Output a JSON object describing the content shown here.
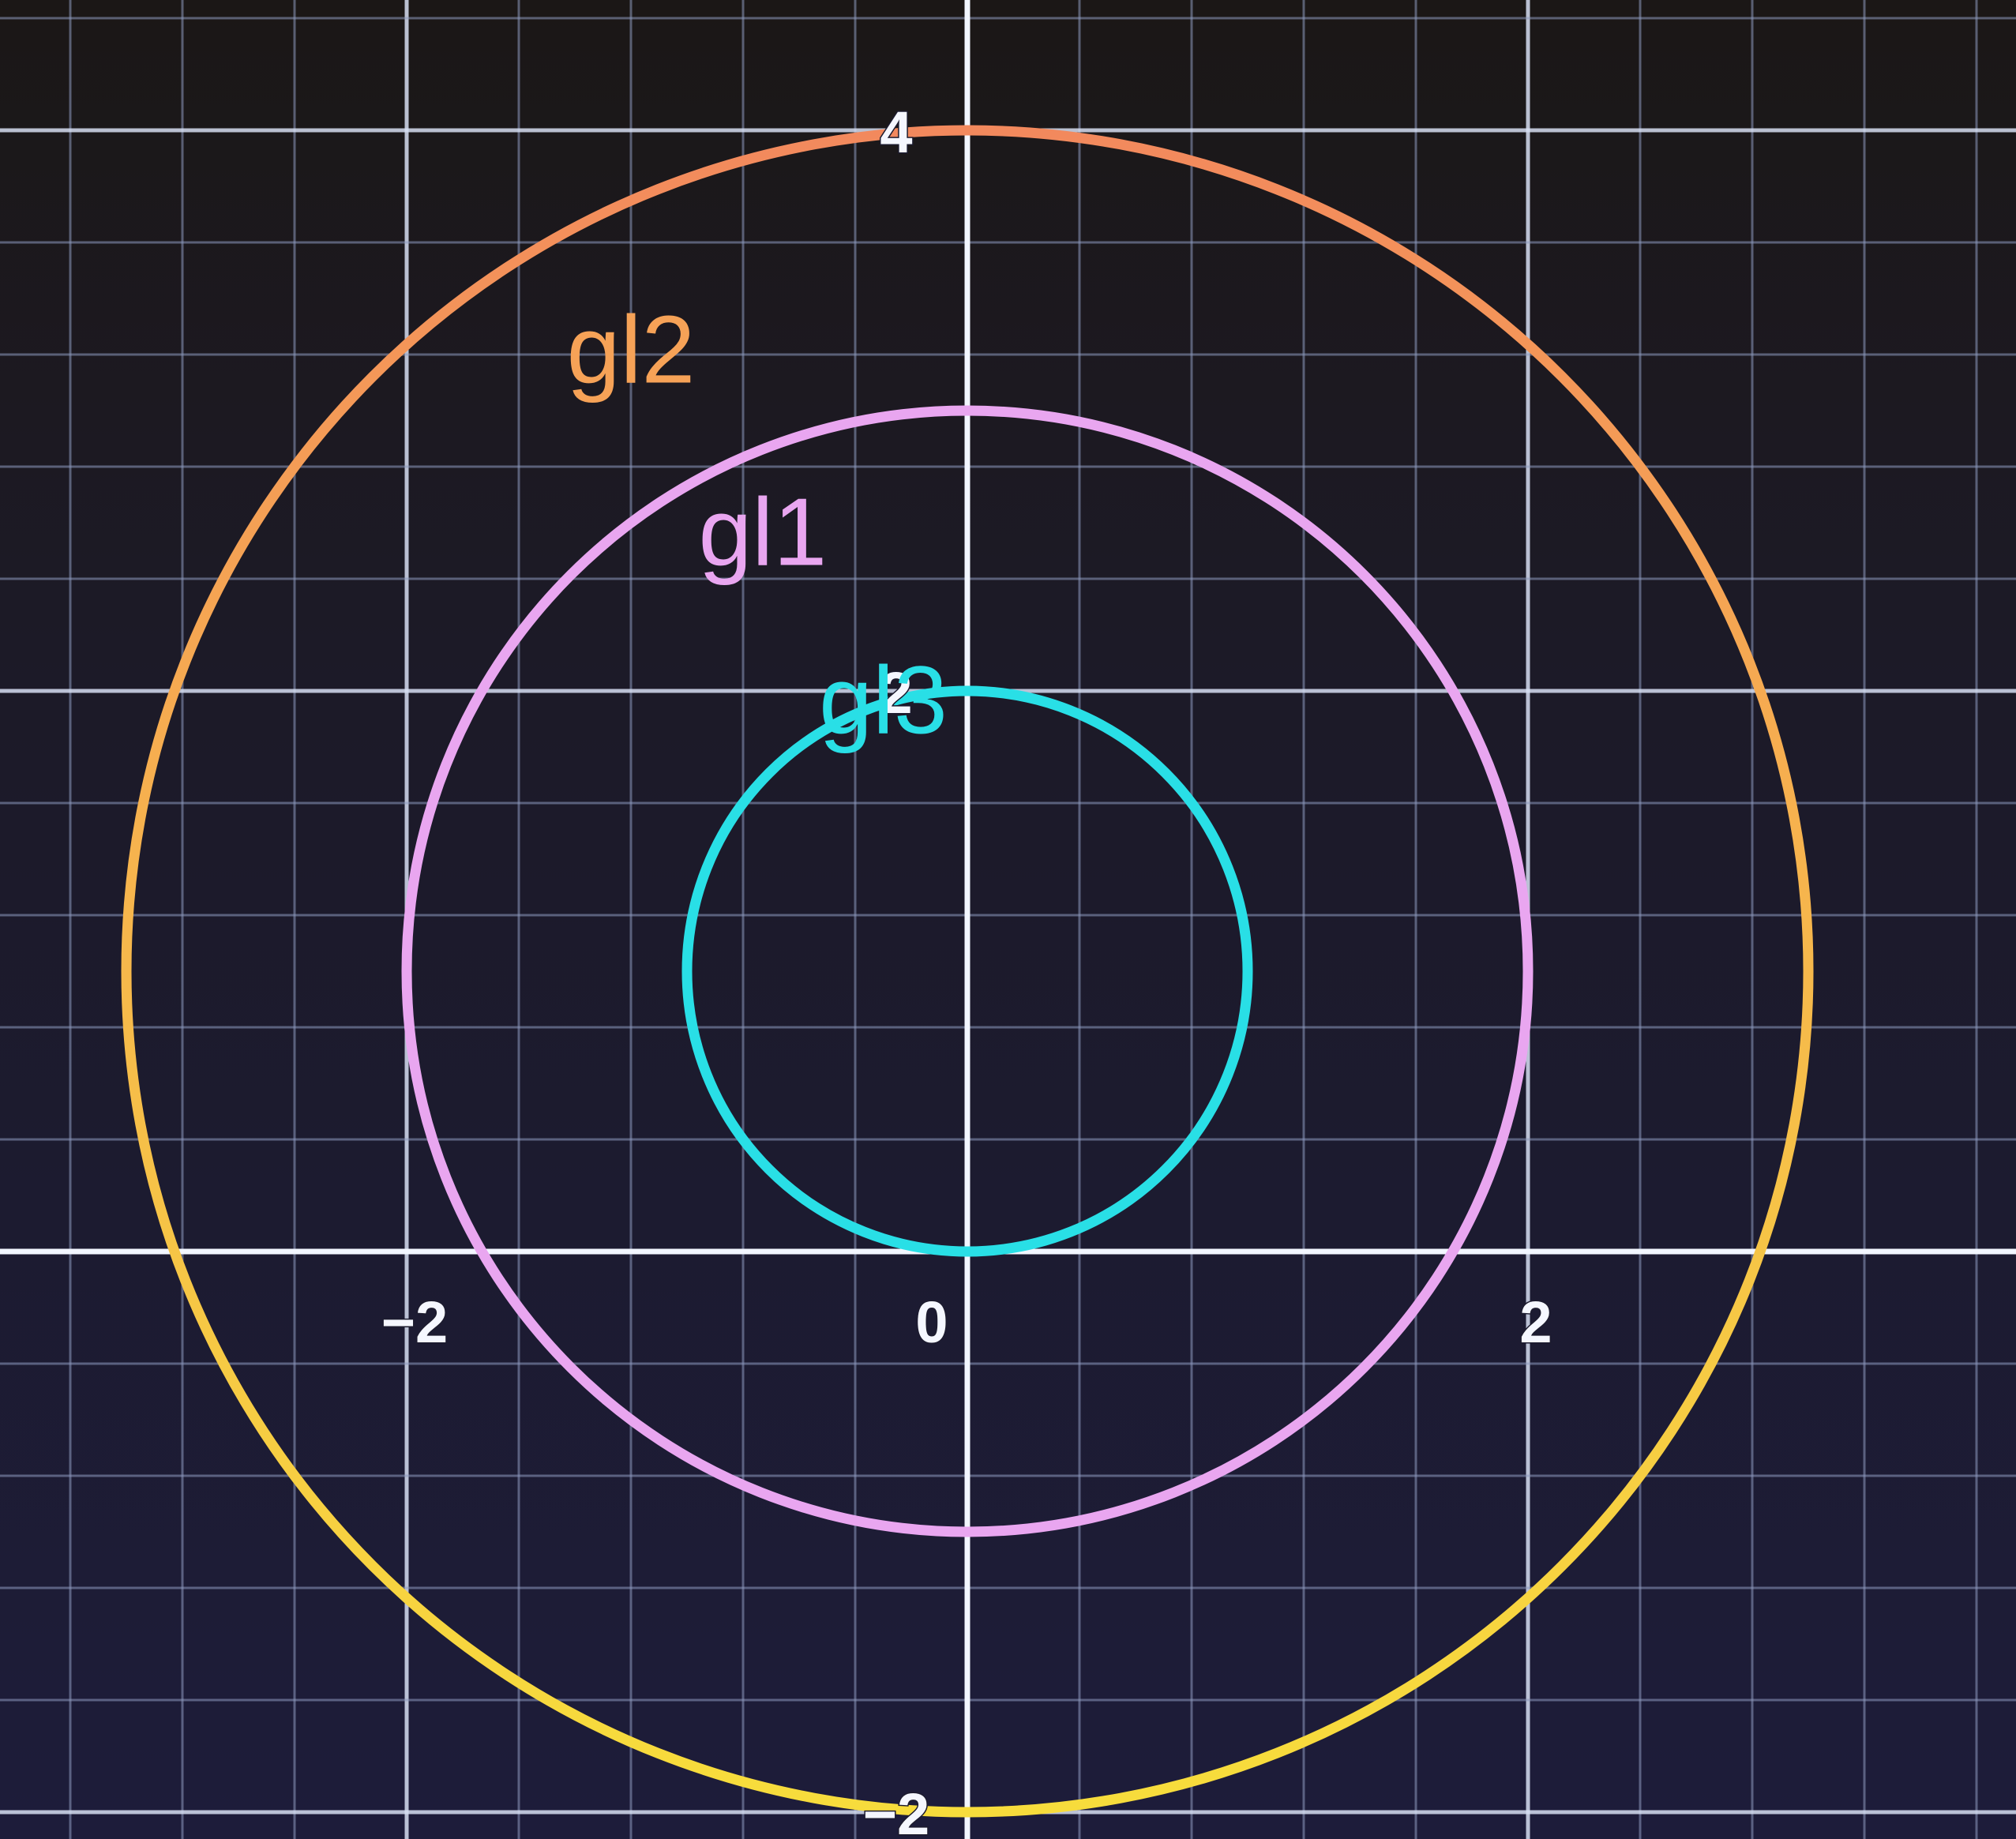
{
  "chart_data": {
    "type": "line",
    "title": "",
    "xlabel": "",
    "ylabel": "",
    "xlim": [
      -3.3,
      3.7
    ],
    "ylim": [
      -2.2,
      4.2
    ],
    "grid": true,
    "x_ticks": [
      {
        "value": -2,
        "label": "−2"
      },
      {
        "value": 0,
        "label": "0"
      },
      {
        "value": 2,
        "label": "2"
      }
    ],
    "y_ticks": [
      {
        "value": 4,
        "label": "4"
      },
      {
        "value": 2,
        "label": "2"
      },
      {
        "value": -2,
        "label": "−2"
      }
    ],
    "series": [
      {
        "name": "gl1",
        "shape": "circle",
        "center": [
          0,
          1
        ],
        "radius": 2,
        "color": "#e9a6f0"
      },
      {
        "name": "gl2",
        "shape": "circle",
        "center": [
          0,
          1
        ],
        "radius": 3,
        "color": "#f5a35a",
        "color_bottom": "#f7dc3c"
      },
      {
        "name": "gl3",
        "shape": "circle",
        "center": [
          0,
          1
        ],
        "radius": 1,
        "color": "#29dfe6"
      }
    ]
  }
}
